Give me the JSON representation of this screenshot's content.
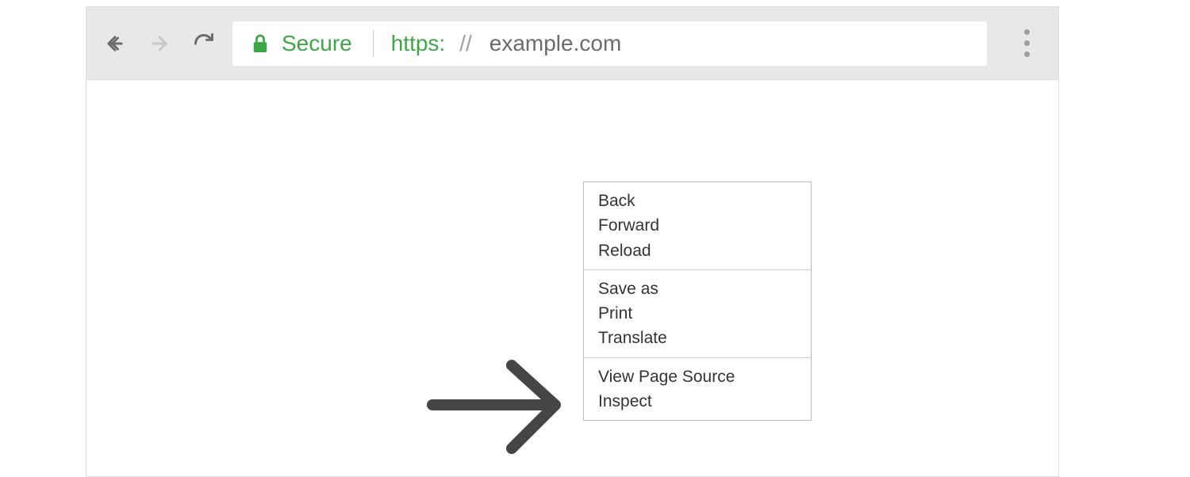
{
  "toolbar": {
    "secure_label": "Secure",
    "protocol": "https:",
    "slashes": "//",
    "domain": "example.com"
  },
  "context_menu": {
    "groups": [
      [
        "Back",
        "Forward",
        "Reload"
      ],
      [
        "Save as",
        "Print",
        "Translate"
      ],
      [
        "View Page Source",
        "Inspect"
      ]
    ],
    "highlighted": "Inspect"
  },
  "colors": {
    "green": "#3fa648",
    "toolbar_bg": "#e8e8e8",
    "arrow": "#454545"
  }
}
